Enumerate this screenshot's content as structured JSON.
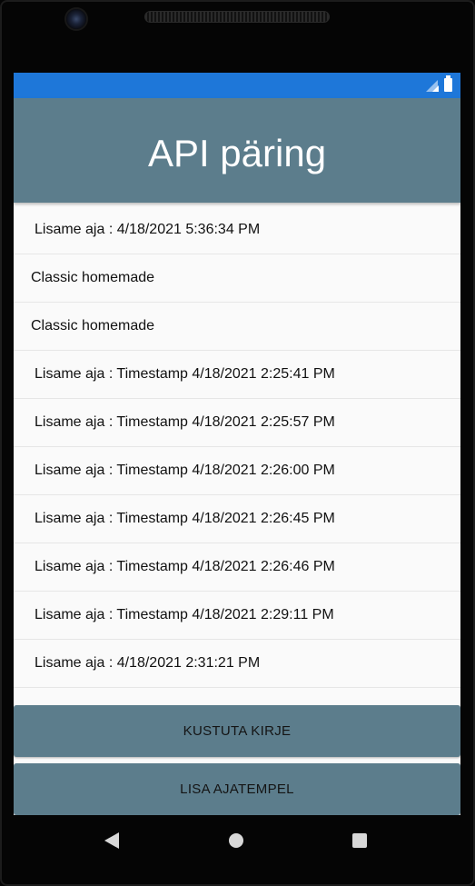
{
  "app": {
    "title": "API päring"
  },
  "list": {
    "items": [
      {
        "text": "Lisame aja :  4/18/2021 5:36:34 PM",
        "style": "indent"
      },
      {
        "text": "Classic homemade",
        "style": "flush"
      },
      {
        "text": "Classic homemade",
        "style": "flush"
      },
      {
        "text": "Lisame aja : Timestamp 4/18/2021 2:25:41 PM",
        "style": "indent"
      },
      {
        "text": "Lisame aja : Timestamp 4/18/2021 2:25:57 PM",
        "style": "indent"
      },
      {
        "text": "Lisame aja : Timestamp 4/18/2021 2:26:00 PM",
        "style": "indent"
      },
      {
        "text": "Lisame aja : Timestamp 4/18/2021 2:26:45 PM",
        "style": "indent"
      },
      {
        "text": "Lisame aja : Timestamp 4/18/2021 2:26:46 PM",
        "style": "indent"
      },
      {
        "text": "Lisame aja : Timestamp 4/18/2021 2:29:11 PM",
        "style": "indent"
      },
      {
        "text": "Lisame aja :  4/18/2021 2:31:21 PM",
        "style": "indent"
      }
    ]
  },
  "buttons": {
    "delete_label": "KUSTUTA KIRJE",
    "add_label": "LISA AJATEMPEL"
  },
  "colors": {
    "status_bar": "#1e77d9",
    "header": "#5c7d8c",
    "button": "#5c7d8c",
    "background": "#fafafa"
  },
  "icons": {
    "status": [
      "signal-icon",
      "battery-icon"
    ],
    "navigation": [
      "back-icon",
      "home-icon",
      "recent-apps-icon"
    ]
  }
}
